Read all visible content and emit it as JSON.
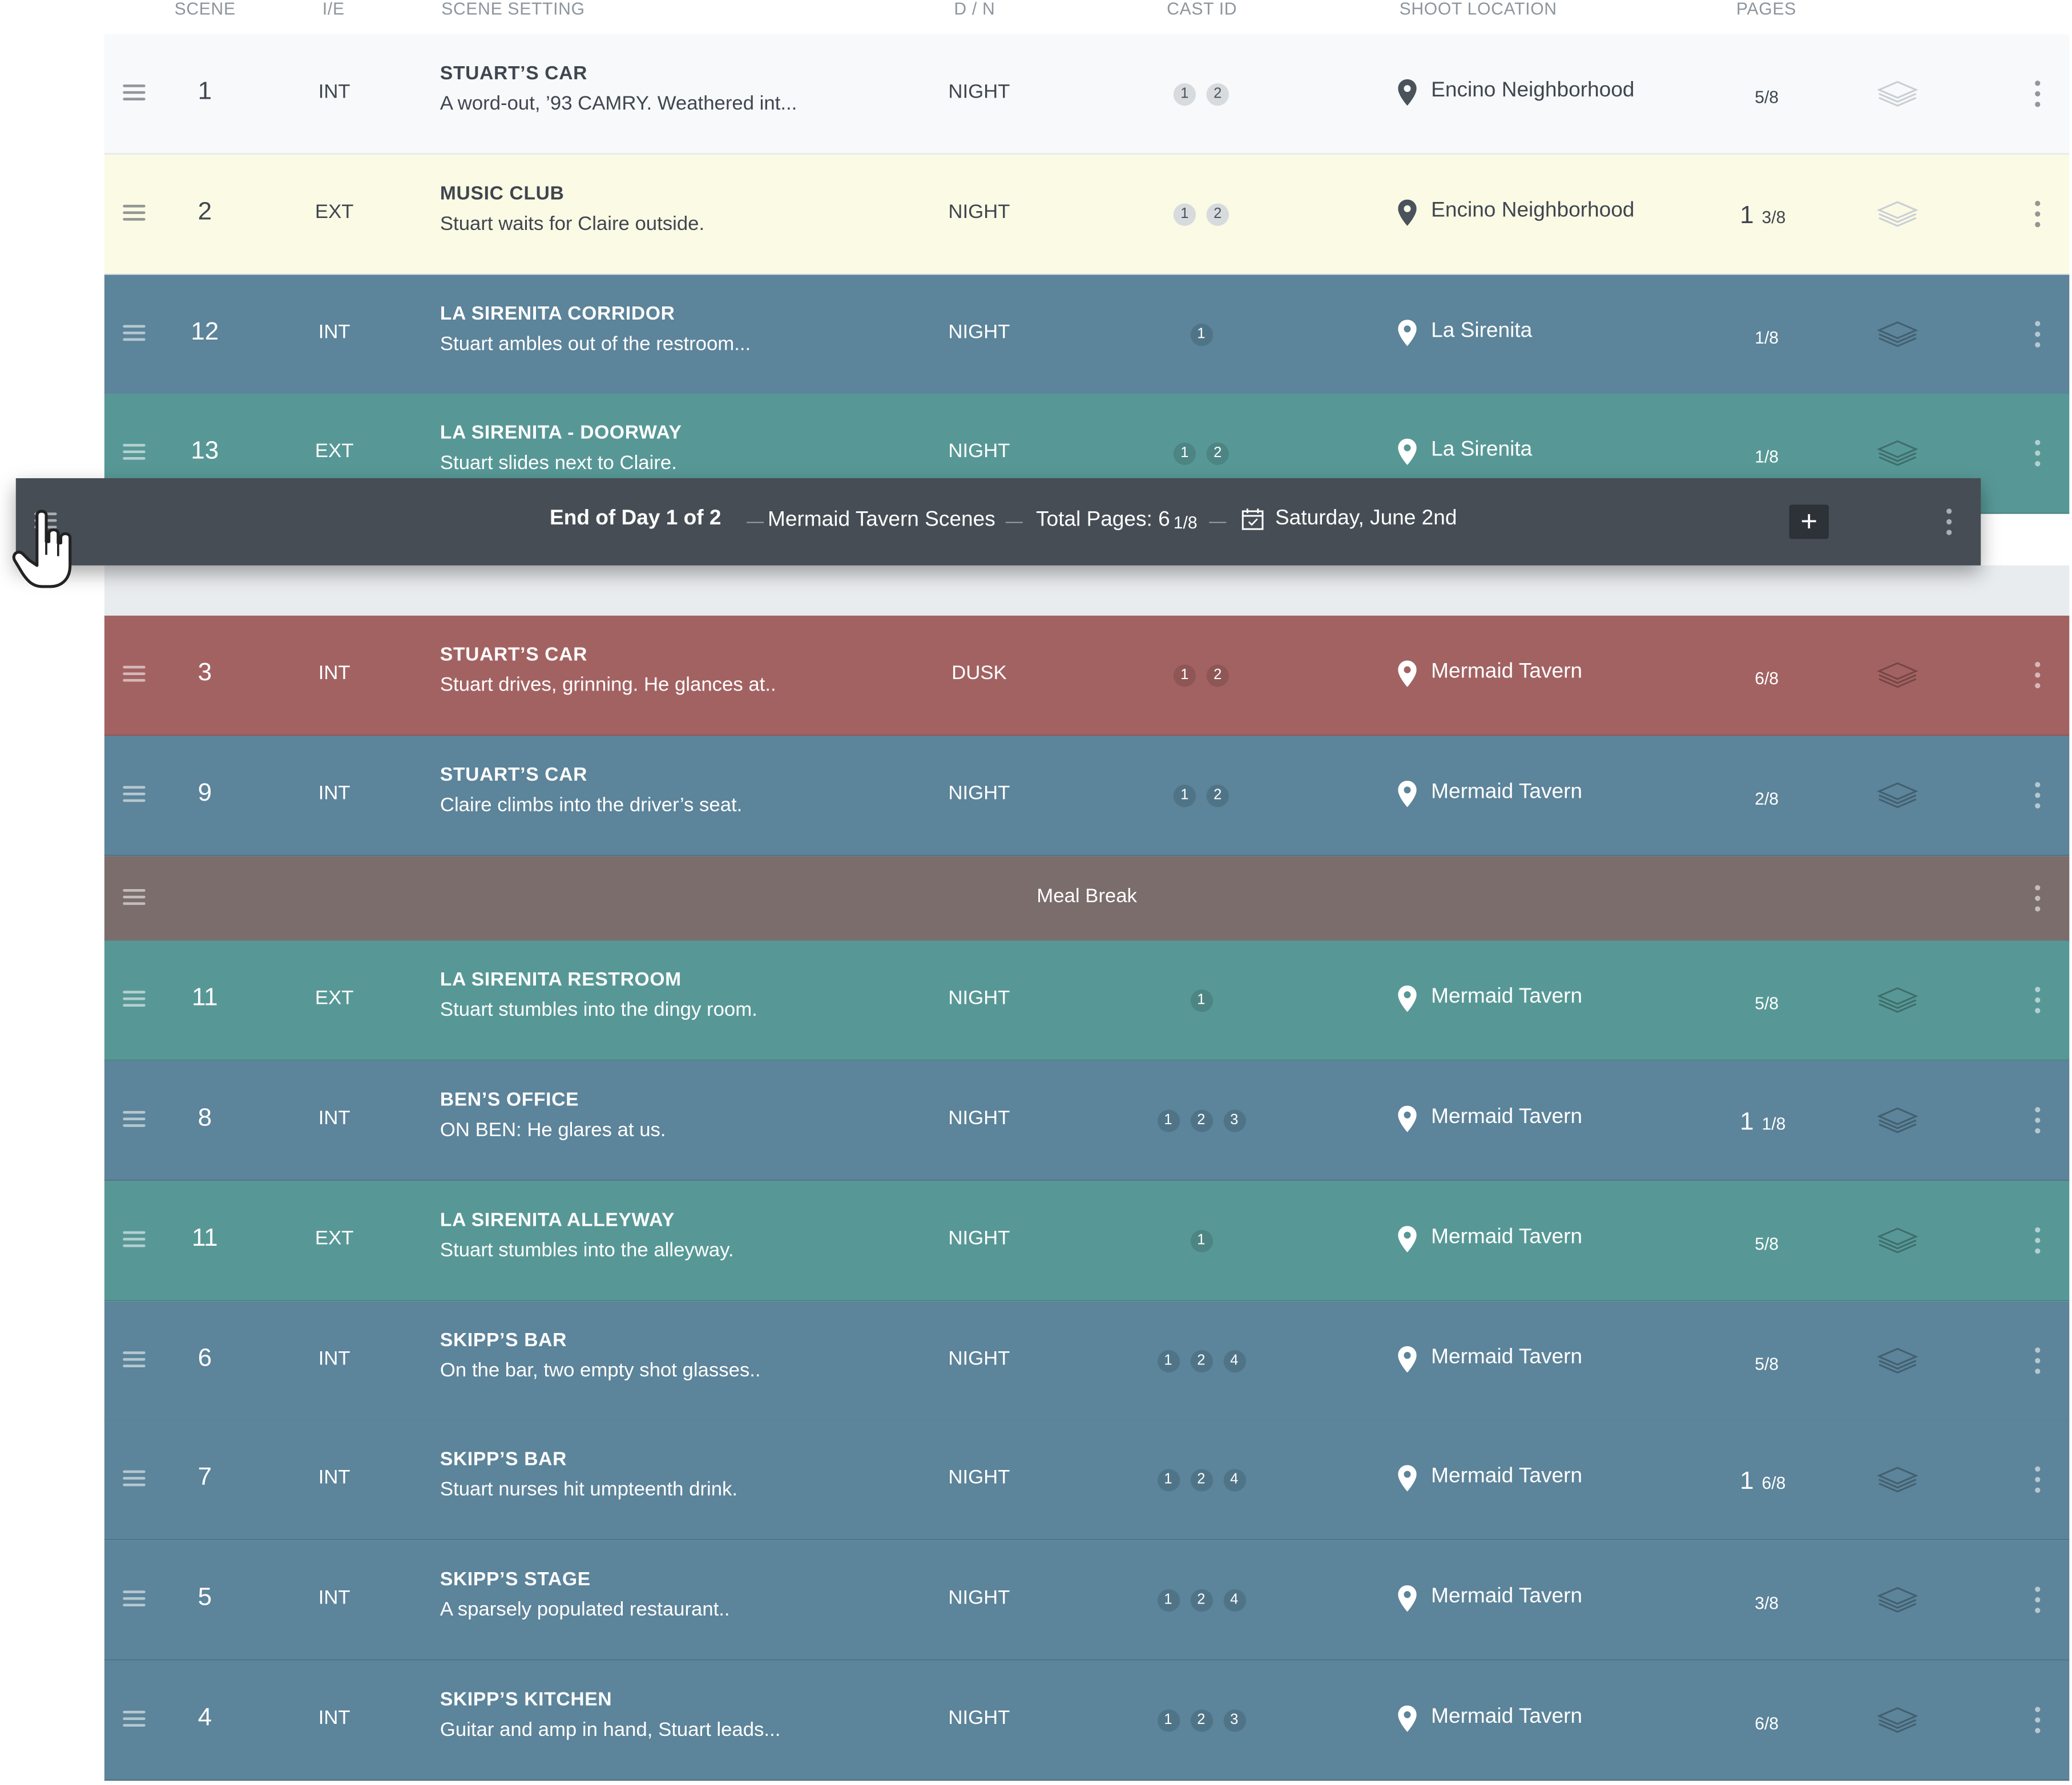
{
  "columns": {
    "scene": "SCENE",
    "ie": "I/E",
    "setting": "SCENE SETTING",
    "dn": "D / N",
    "cast": "CAST ID",
    "location": "SHOOT LOCATION",
    "pages": "PAGES"
  },
  "colors": {
    "white": "#f7f9fa",
    "yellow": "#fbfae4",
    "blue": "#5c849a",
    "teal": "#579896",
    "red": "#a36262",
    "brown": "#7a6d6b",
    "drag_bar": "#464d55"
  },
  "rows_top": [
    {
      "scene": "1",
      "ie": "INT",
      "title": "STUART’S CAR",
      "desc": "A word-out, ’93 CAMRY. Weathered int...",
      "dn": "NIGHT",
      "cast": [
        "1",
        "2"
      ],
      "location": "Encino Neighborhood",
      "pages_whole": "",
      "pages_frac": "5/8",
      "color": "white"
    },
    {
      "scene": "2",
      "ie": "EXT",
      "title": "MUSIC CLUB",
      "desc": "Stuart waits for Claire outside.",
      "dn": "NIGHT",
      "cast": [
        "1",
        "2"
      ],
      "location": "Encino Neighborhood",
      "pages_whole": "1",
      "pages_frac": "3/8",
      "color": "yellow"
    },
    {
      "scene": "12",
      "ie": "INT",
      "title": "LA SIRENITA CORRIDOR",
      "desc": "Stuart ambles out of the restroom...",
      "dn": "NIGHT",
      "cast": [
        "1"
      ],
      "location": "La Sirenita",
      "pages_whole": "",
      "pages_frac": "1/8",
      "color": "blue"
    },
    {
      "scene": "13",
      "ie": "EXT",
      "title": "LA SIRENITA - DOORWAY",
      "desc": "Stuart slides next to Claire.",
      "dn": "NIGHT",
      "cast": [
        "1",
        "2"
      ],
      "location": "La Sirenita",
      "pages_whole": "",
      "pages_frac": "1/8",
      "color": "teal"
    }
  ],
  "drag_bar": {
    "end_of_day": "End of Day 1 of 2",
    "sep": "—",
    "scenes_label": "Mermaid Tavern Scenes",
    "total_pages_label": "Total Pages: 6",
    "total_pages_frac": "1/8",
    "date": "Saturday, June 2nd",
    "add": "+"
  },
  "rows_day2a": [
    {
      "scene": "3",
      "ie": "INT",
      "title": "STUART’S CAR",
      "desc": "Stuart drives, grinning. He glances at..",
      "dn": "DUSK",
      "cast": [
        "1",
        "2"
      ],
      "location": "Mermaid Tavern",
      "pages_whole": "",
      "pages_frac": "6/8",
      "color": "red"
    },
    {
      "scene": "9",
      "ie": "INT",
      "title": "STUART’S CAR",
      "desc": "Claire climbs into the driver’s seat.",
      "dn": "NIGHT",
      "cast": [
        "1",
        "2"
      ],
      "location": "Mermaid Tavern",
      "pages_whole": "",
      "pages_frac": "2/8",
      "color": "blue"
    }
  ],
  "meal_break": {
    "label": "Meal Break"
  },
  "rows_day2b": [
    {
      "scene": "11",
      "ie": "EXT",
      "title": "LA SIRENITA RESTROOM",
      "desc": "Stuart stumbles into the dingy room.",
      "dn": "NIGHT",
      "cast": [
        "1"
      ],
      "location": "Mermaid Tavern",
      "pages_whole": "",
      "pages_frac": "5/8",
      "color": "teal"
    },
    {
      "scene": "8",
      "ie": "INT",
      "title": "BEN’S OFFICE",
      "desc": "ON BEN: He glares at us.",
      "dn": "NIGHT",
      "cast": [
        "1",
        "2",
        "3"
      ],
      "location": "Mermaid Tavern",
      "pages_whole": "1",
      "pages_frac": "1/8",
      "color": "blue"
    },
    {
      "scene": "11",
      "ie": "EXT",
      "title": "LA SIRENITA ALLEYWAY",
      "desc": "Stuart stumbles into the alleyway.",
      "dn": "NIGHT",
      "cast": [
        "1"
      ],
      "location": "Mermaid Tavern",
      "pages_whole": "",
      "pages_frac": "5/8",
      "color": "teal"
    },
    {
      "scene": "6",
      "ie": "INT",
      "title": "SKIPP’S BAR",
      "desc": "On the bar, two empty shot glasses..",
      "dn": "NIGHT",
      "cast": [
        "1",
        "2",
        "4"
      ],
      "location": "Mermaid Tavern",
      "pages_whole": "",
      "pages_frac": "5/8",
      "color": "blue"
    },
    {
      "scene": "7",
      "ie": "INT",
      "title": "SKIPP’S BAR",
      "desc": "Stuart nurses hit umpteenth drink.",
      "dn": "NIGHT",
      "cast": [
        "1",
        "2",
        "4"
      ],
      "location": "Mermaid Tavern",
      "pages_whole": "1",
      "pages_frac": "6/8",
      "color": "blue"
    },
    {
      "scene": "5",
      "ie": "INT",
      "title": "SKIPP’S STAGE",
      "desc": "A sparsely populated restaurant..",
      "dn": "NIGHT",
      "cast": [
        "1",
        "2",
        "4"
      ],
      "location": "Mermaid Tavern",
      "pages_whole": "",
      "pages_frac": "3/8",
      "color": "blue"
    },
    {
      "scene": "4",
      "ie": "INT",
      "title": "SKIPP’S KITCHEN",
      "desc": "Guitar and amp in hand, Stuart leads...",
      "dn": "NIGHT",
      "cast": [
        "1",
        "2",
        "3"
      ],
      "location": "Mermaid Tavern",
      "pages_whole": "",
      "pages_frac": "6/8",
      "color": "blue"
    }
  ]
}
